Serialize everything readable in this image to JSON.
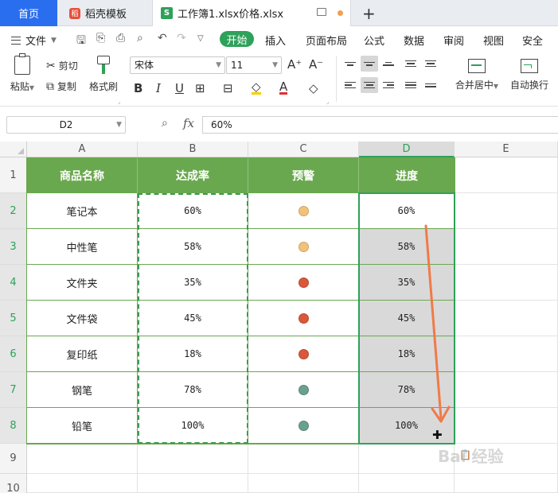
{
  "tabs": {
    "home": "首页",
    "template": "稻壳模板",
    "document": "工作簿1.xlsx价格.xlsx",
    "new_tab": "+"
  },
  "menu": {
    "file": "文件",
    "items": [
      "开始",
      "插入",
      "页面布局",
      "公式",
      "数据",
      "审阅",
      "视图",
      "安全"
    ]
  },
  "ribbon": {
    "paste": "粘贴",
    "cut": "剪切",
    "copy": "复制",
    "format_painter": "格式刷",
    "font_name": "宋体",
    "font_size": "11",
    "merge_center": "合并居中",
    "wrap_text": "自动换行"
  },
  "formula_bar": {
    "cell_ref": "D2",
    "fx": "fx",
    "content": "60%"
  },
  "sheet": {
    "columns": [
      "A",
      "B",
      "C",
      "D",
      "E"
    ],
    "rows": [
      "1",
      "2",
      "3",
      "4",
      "5",
      "6",
      "7",
      "8",
      "9",
      "10"
    ],
    "headers": [
      "商品名称",
      "达成率",
      "预警",
      "进度"
    ],
    "data": [
      {
        "name": "笔记本",
        "rate": "60%",
        "warn": "#f2c27a",
        "progress": "60%"
      },
      {
        "name": "中性笔",
        "rate": "58%",
        "warn": "#f2c27a",
        "progress": "58%"
      },
      {
        "name": "文件夹",
        "rate": "35%",
        "warn": "#d9583b",
        "progress": "35%"
      },
      {
        "name": "文件袋",
        "rate": "45%",
        "warn": "#d9583b",
        "progress": "45%"
      },
      {
        "name": "复印纸",
        "rate": "18%",
        "warn": "#d9583b",
        "progress": "18%"
      },
      {
        "name": "钢笔",
        "rate": "78%",
        "warn": "#6aa08c",
        "progress": "78%"
      },
      {
        "name": "铅笔",
        "rate": "100%",
        "warn": "#6aa08c",
        "progress": "100%"
      }
    ]
  },
  "colors": {
    "accent_green": "#2ea15a",
    "header_fill": "#6aa84f",
    "tab_blue": "#2a6ef0",
    "arrow": "#f07a48"
  },
  "watermark": "Bai 经验"
}
